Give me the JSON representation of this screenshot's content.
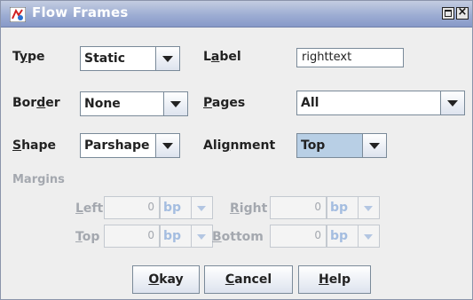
{
  "window": {
    "title": "Flow Frames"
  },
  "fields": {
    "type": {
      "label_pre": "T",
      "label_mn": "y",
      "label_post": "pe",
      "value": "Static"
    },
    "label": {
      "label_pre": "L",
      "label_mn": "a",
      "label_post": "bel",
      "value": "righttext"
    },
    "border": {
      "label_pre": "Bor",
      "label_mn": "d",
      "label_post": "er",
      "value": "None"
    },
    "pages": {
      "label_pre": "",
      "label_mn": "P",
      "label_post": "ages",
      "value": "All"
    },
    "shape": {
      "label_pre": "",
      "label_mn": "S",
      "label_post": "hape",
      "value": "Parshape"
    },
    "alignment": {
      "label_pre": "Ali",
      "label_mn": "g",
      "label_post": "nment",
      "value": "Top"
    }
  },
  "margins": {
    "heading": "Margins",
    "left": {
      "label_mn": "L",
      "label_post": "eft",
      "value": "0",
      "unit": "bp"
    },
    "right": {
      "label_mn": "R",
      "label_post": "ight",
      "value": "0",
      "unit": "bp"
    },
    "top": {
      "label_mn": "T",
      "label_post": "op",
      "value": "0",
      "unit": "bp"
    },
    "bottom": {
      "label_mn": "B",
      "label_post": "ottom",
      "value": "0",
      "unit": "bp"
    }
  },
  "buttons": {
    "okay": {
      "mn": "O",
      "rest": "kay"
    },
    "cancel": {
      "mn": "C",
      "rest": "ancel"
    },
    "help": {
      "mn": "H",
      "rest": "elp"
    }
  },
  "colors": {
    "titlebar": "#9dadd3",
    "selected": "#b8cfe5",
    "disabled_text": "#a4a8af"
  }
}
